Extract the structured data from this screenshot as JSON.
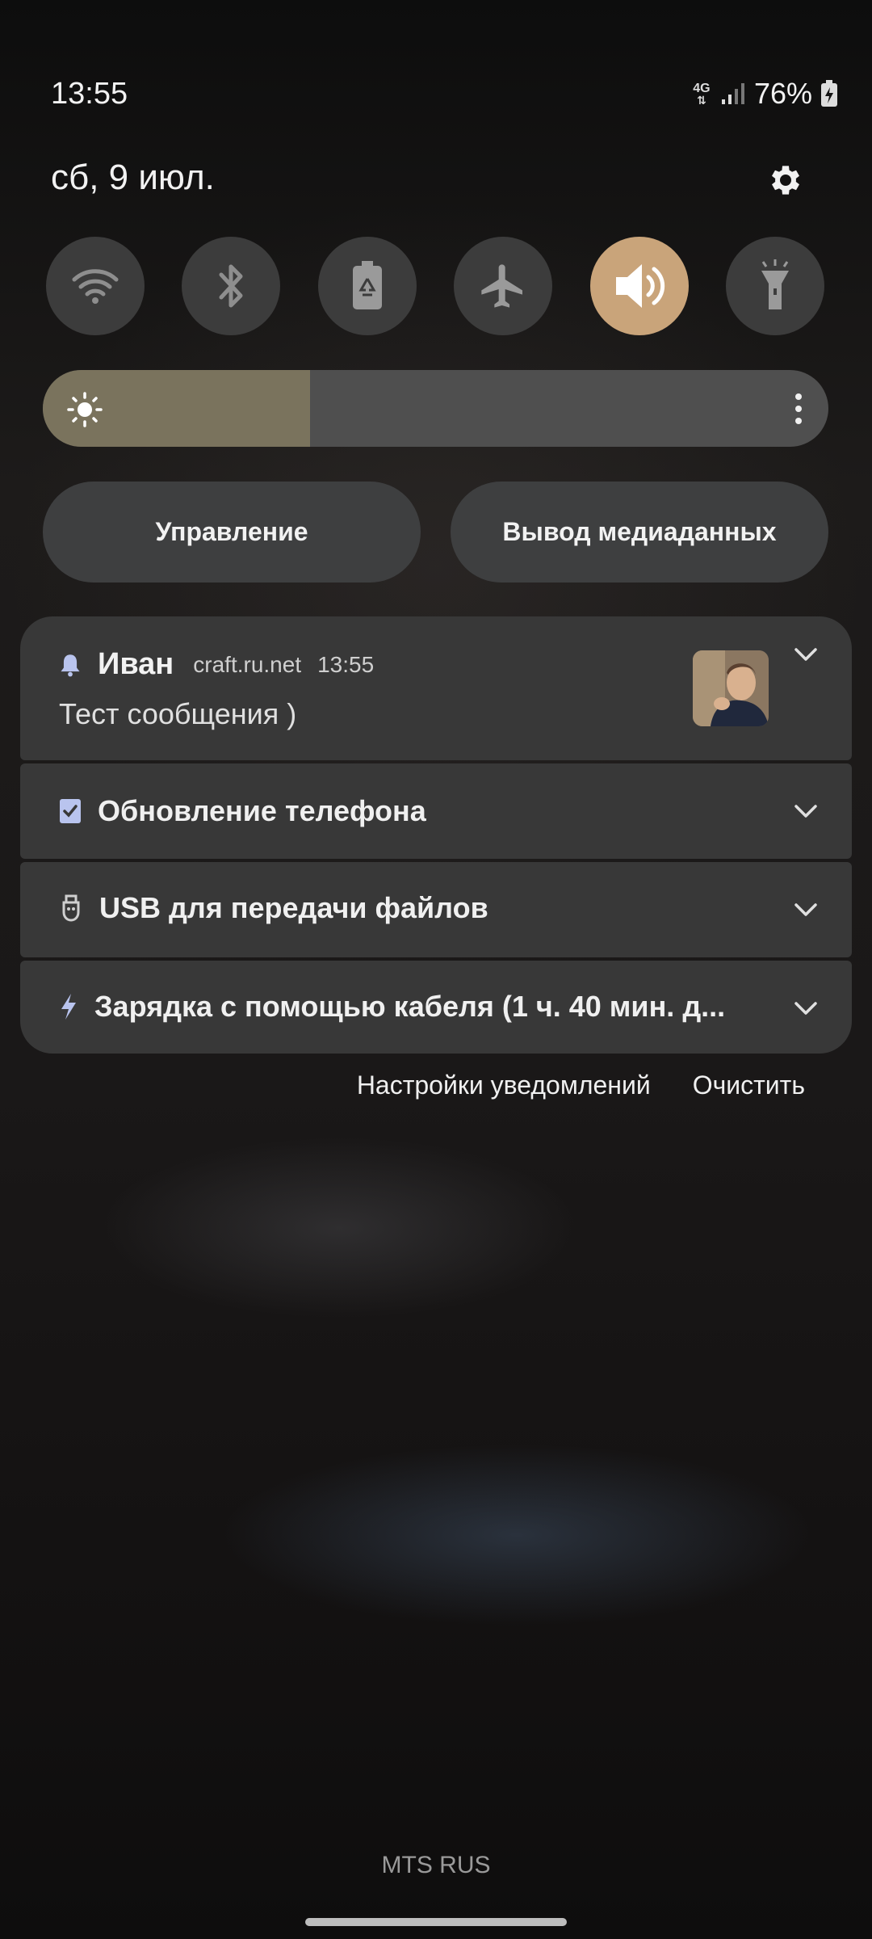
{
  "status_bar": {
    "time": "13:55",
    "network_type": "4G",
    "battery_percent": "76%"
  },
  "header": {
    "date": "сб, 9 июл.",
    "settings_icon": "gear-icon"
  },
  "quick_toggles": [
    {
      "name": "wifi",
      "icon": "wifi-icon",
      "active": false
    },
    {
      "name": "bluetooth",
      "icon": "bluetooth-icon",
      "active": false
    },
    {
      "name": "power-saving",
      "icon": "battery-saver-icon",
      "active": false
    },
    {
      "name": "airplane",
      "icon": "airplane-icon",
      "active": false
    },
    {
      "name": "sound",
      "icon": "speaker-icon",
      "active": true
    },
    {
      "name": "flashlight",
      "icon": "flashlight-icon",
      "active": false
    }
  ],
  "brightness": {
    "level_fraction": 0.34
  },
  "buttons": {
    "device_control": "Управление",
    "media_output": "Вывод медиаданных"
  },
  "notifications": [
    {
      "type": "message",
      "sender": "Иван",
      "app_source": "craft.ru.net",
      "time": "13:55",
      "text": "Тест сообщения )"
    },
    {
      "type": "system",
      "title": "Обновление телефона"
    },
    {
      "type": "system",
      "title": "USB для передачи файлов"
    },
    {
      "type": "system",
      "title": "Зарядка с помощью кабеля (1 ч. 40 мин. д..."
    }
  ],
  "notification_actions": {
    "settings": "Настройки уведомлений",
    "clear": "Очистить"
  },
  "carrier": "MTS RUS",
  "colors": {
    "accent": "#c9a47a",
    "card": "#383838",
    "toggle": "#3c3c3c"
  }
}
